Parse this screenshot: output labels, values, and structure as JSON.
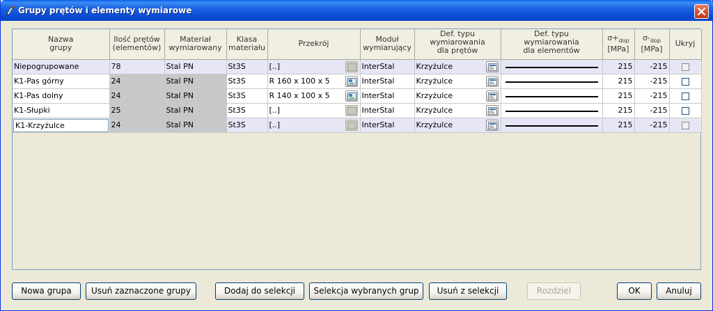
{
  "window": {
    "title": "Grupy prętów i elementy wymiarowe"
  },
  "table": {
    "headers": {
      "name": [
        "Nazwa",
        "grupy"
      ],
      "count": [
        "Ilość prętów",
        "(elementów)"
      ],
      "material": [
        "Materiał",
        "wymiarowany"
      ],
      "class": [
        "Klasa",
        "materiału"
      ],
      "section": [
        "Przekrój"
      ],
      "module": [
        "Moduł",
        "wymiarujący"
      ],
      "bartype": [
        "Def. typu",
        "wymiarowania",
        "dla prętów"
      ],
      "eltype": [
        "Def. typu",
        "wymiarowania",
        "dla elementów"
      ],
      "sigma_plus": {
        "symbol": "σ+",
        "sub": "dop",
        "unit": "[MPa]"
      },
      "sigma_minus": {
        "symbol": "σ-",
        "sub": "dop",
        "unit": "[MPa]"
      },
      "hide": "Ukryj"
    },
    "rows": [
      {
        "name": "Niepogrupowane",
        "count": "78",
        "material": "Stal PN",
        "class": "St3S",
        "section": "[..]",
        "module": "InterStal",
        "bartype": "Krzyżulce",
        "sigma_plus": "215",
        "sigma_minus": "-215",
        "hidden": false
      },
      {
        "name": "K1-Pas górny",
        "count": "24",
        "material": "Stal PN",
        "class": "St3S",
        "section": "R 160 x 100 x 5",
        "module": "InterStal",
        "bartype": "Krzyżulce",
        "sigma_plus": "215",
        "sigma_minus": "-215",
        "hidden": false
      },
      {
        "name": "K1-Pas dolny",
        "count": "24",
        "material": "Stal PN",
        "class": "St3S",
        "section": "R 140 x 100 x 5",
        "module": "InterStal",
        "bartype": "Krzyżulce",
        "sigma_plus": "215",
        "sigma_minus": "-215",
        "hidden": false
      },
      {
        "name": "K1-Słupki",
        "count": "25",
        "material": "Stal PN",
        "class": "St3S",
        "section": "[..]",
        "module": "InterStal",
        "bartype": "Krzyżulce",
        "sigma_plus": "215",
        "sigma_minus": "-215",
        "hidden": false
      },
      {
        "name": "K1-Krzyżulce",
        "count": "24",
        "material": "Stal PN",
        "class": "St3S",
        "section": "[..]",
        "module": "InterStal",
        "bartype": "Krzyżulce",
        "sigma_plus": "215",
        "sigma_minus": "-215",
        "hidden": false
      }
    ],
    "editing_row": 4
  },
  "buttons": {
    "new_group": "Nowa grupa",
    "delete_groups": "Usuń zaznaczone grupy",
    "add_to_selection": "Dodaj do selekcji",
    "select_groups": "Selekcja wybranych grup",
    "remove_from_selection": "Usuń z selekcji",
    "split": "Rozdziel",
    "ok": "OK",
    "cancel": "Anuluj"
  },
  "colors": {
    "titlebar": "#0A5FE8",
    "selected_row": "#E6E6F6",
    "readonly_cell": "#C8C8C8",
    "dialog_bg": "#ECE9D8"
  }
}
